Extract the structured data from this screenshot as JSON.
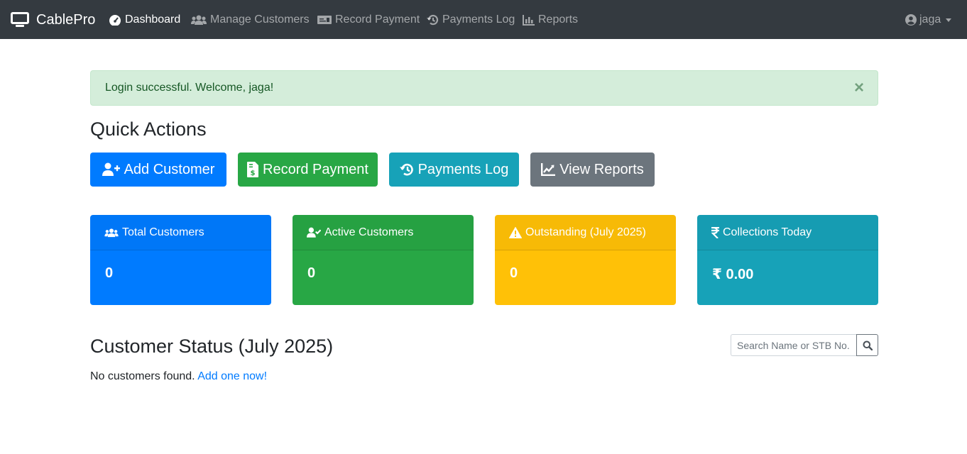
{
  "navbar": {
    "brand": "CablePro",
    "items": [
      {
        "label": "Dashboard",
        "icon": "tachometer-icon",
        "active": true
      },
      {
        "label": "Manage Customers",
        "icon": "users-icon"
      },
      {
        "label": "Record Payment",
        "icon": "money-bill-icon"
      },
      {
        "label": "Payments Log",
        "icon": "history-icon"
      },
      {
        "label": "Reports",
        "icon": "chart-bar-icon"
      }
    ],
    "user": "jaga"
  },
  "alert": {
    "message": "Login successful. Welcome, jaga!",
    "close_symbol": "×"
  },
  "quick_actions": {
    "title": "Quick Actions",
    "buttons": [
      {
        "label": "Add Customer",
        "icon": "user-plus-icon",
        "color": "#007bff"
      },
      {
        "label": "Record Payment",
        "icon": "file-invoice-dollar-icon",
        "color": "#28a745"
      },
      {
        "label": "Payments Log",
        "icon": "history-icon",
        "color": "#17a2b8"
      },
      {
        "label": "View Reports",
        "icon": "chart-line-icon",
        "color": "#6c757d"
      }
    ]
  },
  "stats": [
    {
      "label": "Total Customers",
      "value": "0",
      "icon": "users-icon",
      "color": "#007bff"
    },
    {
      "label": "Active Customers",
      "value": "0",
      "icon": "user-check-icon",
      "color": "#28a745"
    },
    {
      "label": "Outstanding (July 2025)",
      "value": "0",
      "icon": "warning-icon",
      "color": "#ffc107"
    },
    {
      "label": "Collections Today",
      "value": "₹ 0.00",
      "icon": "rupee-icon",
      "color": "#17a2b8"
    }
  ],
  "customer_status": {
    "title": "Customer Status (July 2025)",
    "search_placeholder": "Search Name or STB No.",
    "empty_message": "No customers found.",
    "empty_link": "Add one now!"
  }
}
